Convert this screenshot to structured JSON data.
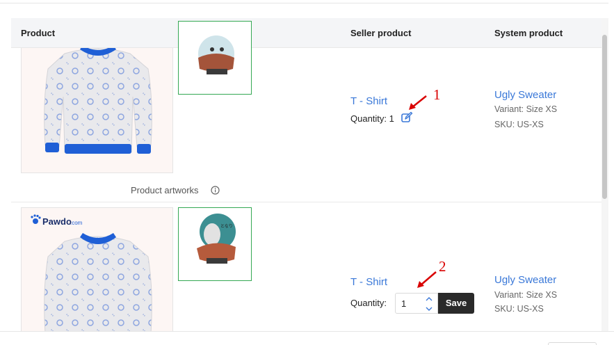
{
  "table": {
    "headers": {
      "product": "Product",
      "seller_product": "Seller product",
      "system_product": "System product"
    }
  },
  "rows": [
    {
      "product_artworks_label": "Product artworks",
      "seller": {
        "name": "T - Shirt",
        "quantity_label": "Quantity:",
        "quantity_value": "1"
      },
      "system": {
        "name": "Ugly Sweater",
        "variant": "Variant: Size XS",
        "sku": "SKU: US-XS"
      }
    },
    {
      "brand": "Pawdo.com",
      "seller": {
        "name": "T - Shirt",
        "quantity_label": "Quantity:",
        "quantity_value": "1",
        "save_label": "Save"
      },
      "system": {
        "name": "Ugly Sweater",
        "variant": "Variant: Size XS",
        "sku": "SKU: US-XS"
      }
    }
  ],
  "annotations": [
    "1",
    "2"
  ],
  "colors": {
    "link": "#3a78d8",
    "annotation": "#d90000",
    "artwork_border": "#34a853",
    "save_button": "#2a2a2a",
    "sweater_trim": "#1f5fd6"
  },
  "icons": {
    "edit": "edit-icon",
    "info": "info-icon",
    "stepper": "chevron-up-down-icon",
    "arrow": "red-arrow-icon"
  }
}
